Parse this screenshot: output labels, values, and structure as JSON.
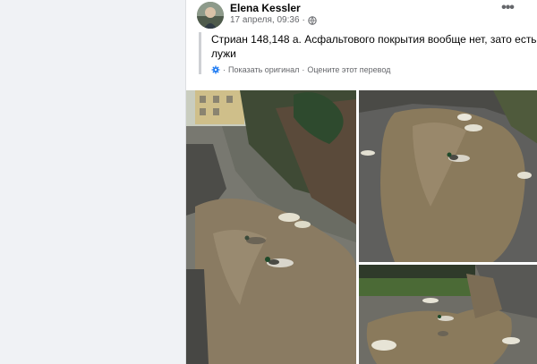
{
  "post": {
    "author": "Elena Kessler",
    "timestamp": "17 апреля, 09:36",
    "privacy_separator": "·",
    "text": "Стриан 148,148 а. Асфальтового покрытия вообще нет, зато есть лужи",
    "translation": {
      "prefix": "·",
      "show_original": "Показать оригинал",
      "separator": "·",
      "rate": "Оцените этот перевод"
    },
    "more_label": "•••"
  },
  "colors": {
    "name": "#050505",
    "meta": "#65676b",
    "accent": "#1877f2",
    "puddle": "#8a7b62",
    "asphalt": "#5f5f5d"
  },
  "photos": [
    {
      "name": "main-photo",
      "subject": "puddle-with-ducks-street"
    },
    {
      "name": "top-right-photo",
      "subject": "puddle-with-duck"
    },
    {
      "name": "bottom-right-photo",
      "subject": "puddle-with-ducks-garden"
    }
  ]
}
